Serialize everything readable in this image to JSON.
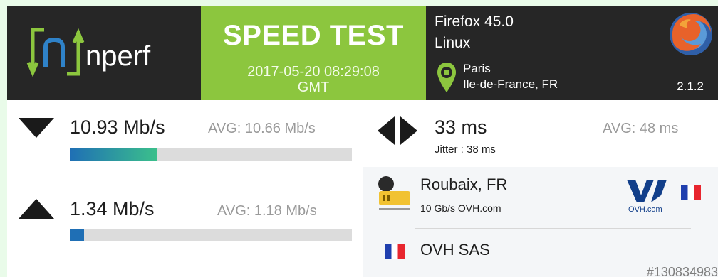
{
  "brand": {
    "name": "nperf"
  },
  "header": {
    "title": "SPEED TEST",
    "date": "2017-05-20 08:29:08",
    "tz": "GMT",
    "browser": "Firefox 45.0",
    "os": "Linux",
    "city": "Paris",
    "region": "Ile-de-France, FR",
    "version": "2.1.2"
  },
  "download": {
    "value": "10.93 Mb/s",
    "avg": "AVG: 10.66 Mb/s",
    "fraction": 0.31
  },
  "upload": {
    "value": "1.34 Mb/s",
    "avg": "AVG: 1.18 Mb/s",
    "fraction": 0.05
  },
  "latency": {
    "value": "33 ms",
    "avg": "AVG: 48 ms",
    "jitter": "Jitter : 38 ms"
  },
  "server": {
    "location": "Roubaix, FR",
    "link": "10 Gb/s OVH.com",
    "provider_logo_text": "OVH.com"
  },
  "isp": {
    "name": "OVH SAS"
  },
  "result_id": "#130834983",
  "colors": {
    "accent_green": "#8cc63e",
    "header_dark": "#262626",
    "bar_blue": "#1f6fb5",
    "bar_teal": "#3bc08b"
  }
}
